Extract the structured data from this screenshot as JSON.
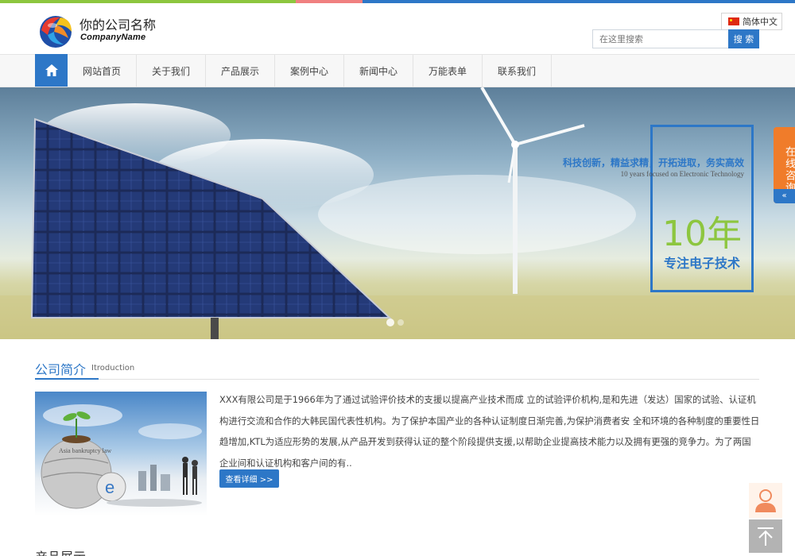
{
  "brand": {
    "name_cn": "你的公司名称",
    "name_en": "CompanyName"
  },
  "header": {
    "language": "简体中文",
    "search_placeholder": "在这里搜索",
    "search_button": "搜 索"
  },
  "nav": {
    "home_icon": "home-icon",
    "items": [
      {
        "label": "网站首页"
      },
      {
        "label": "关于我们"
      },
      {
        "label": "产品展示"
      },
      {
        "label": "案例中心"
      },
      {
        "label": "新闻中心"
      },
      {
        "label": "万能表单"
      },
      {
        "label": "联系我们"
      }
    ]
  },
  "banner": {
    "tagline": "科技创新，精益求精，开拓进取，务实高效",
    "subtitle": "10 years focused on Electronic Technology",
    "years": "10年",
    "focus": "专注电子技术"
  },
  "consult": {
    "label": "在线咨询",
    "arrow": "«"
  },
  "intro": {
    "title": "公司简介",
    "subtitle": "Itroduction",
    "image_caption": "Asia bankruptcy law",
    "text": "XXX有限公司是于1966年为了通过试验评价技术的支援以提高产业技术而成 立的试验评价机构,是和先进（发达）国家的试验、认证机构进行交流和合作的大韩民国代表性机构。为了保护本国产业的各种认证制度日渐完善,为保护消费者安 全和环境的各种制度的重要性日趋增加,KTL为适应形势的发展,从产品开发到获得认证的整个阶段提供支援,以帮助企业提高技术能力以及拥有更强的竞争力。为了两国企业间和认证机构和客户间的有..",
    "more_button": "查看详细 >>"
  },
  "next_section": {
    "title": "产品展示"
  },
  "colors": {
    "primary": "#2d77c7",
    "green": "#8dc63f",
    "orange": "#f07c2a",
    "pink": "#f08080"
  }
}
